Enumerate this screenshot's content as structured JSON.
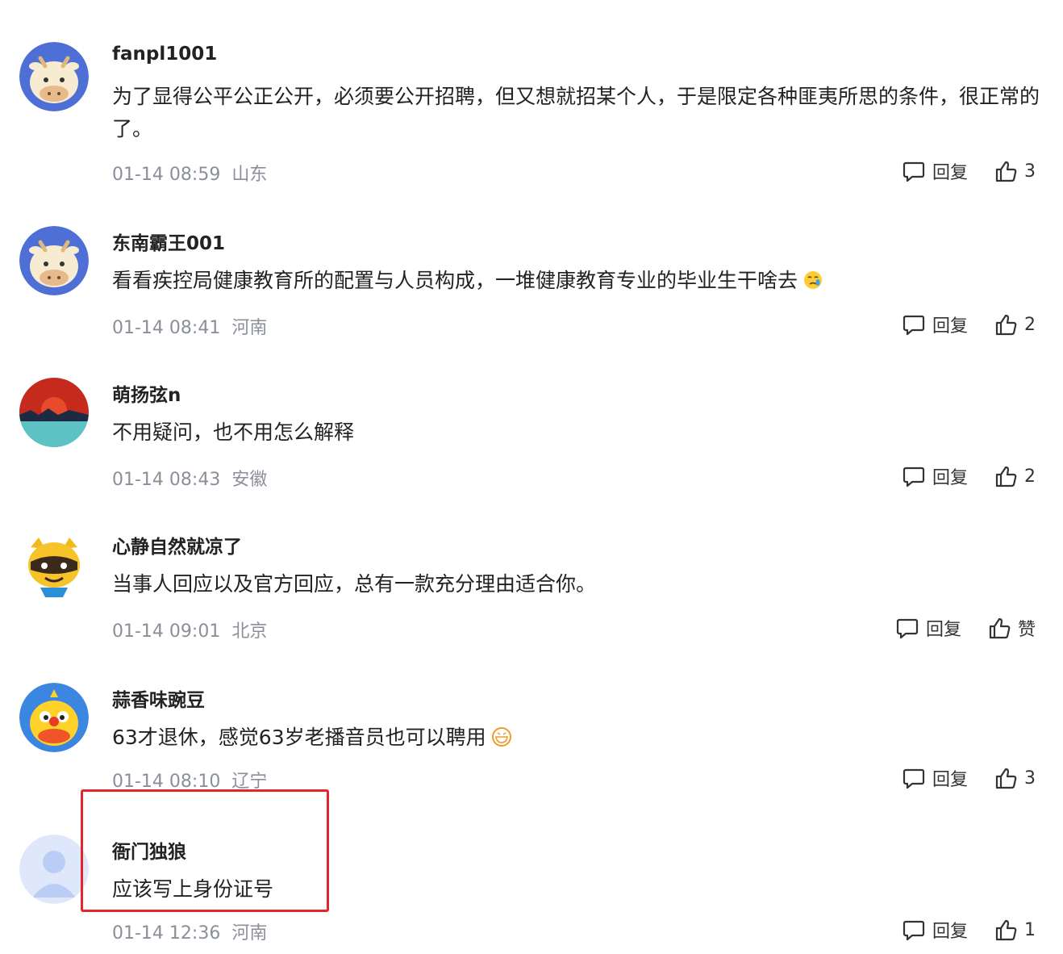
{
  "comments": [
    {
      "username": "fanpl1001",
      "text": "为了显得公平公正公开，必须要公开招聘，但又想就招某个人，于是限定各种匪夷所思的条件，很正常的了。",
      "time": "01-14 08:59",
      "location": "山东",
      "reply_label": "回复",
      "likes": "3",
      "avatar": "cow-avatar"
    },
    {
      "username": "东南霸王001",
      "text": "看看疾控局健康教育所的配置与人员构成，一堆健康教育专业的毕业生干啥去",
      "emoji": "crying-face-emoji",
      "time": "01-14 08:41",
      "location": "河南",
      "reply_label": "回复",
      "likes": "2",
      "avatar": "cow-avatar"
    },
    {
      "username": "萌扬弦n",
      "text": "不用疑问，也不用怎么解释",
      "time": "01-14 08:43",
      "location": "安徽",
      "reply_label": "回复",
      "likes": "2",
      "avatar": "sunset-avatar"
    },
    {
      "username": "心静自然就凉了",
      "text": "当事人回应以及官方回应，总有一款充分理由适合你。",
      "time": "01-14 09:01",
      "location": "北京",
      "reply_label": "回复",
      "likes": "赞",
      "avatar": "raccoon-avatar"
    },
    {
      "username": "蒜香味豌豆",
      "text": "63才退休，感觉63岁老播音员也可以聘用",
      "emoji": "grinning-face-emoji",
      "time": "01-14 08:10",
      "location": "辽宁",
      "reply_label": "回复",
      "likes": "3",
      "avatar": "duck-avatar"
    },
    {
      "username": "衙门独狼",
      "text": "应该写上身份证号",
      "time": "01-14 12:36",
      "location": "河南",
      "reply_label": "回复",
      "likes": "1",
      "avatar": "default-avatar"
    }
  ],
  "colors": {
    "meta_text": "#8a8f99",
    "highlight_border": "#e3262b"
  }
}
